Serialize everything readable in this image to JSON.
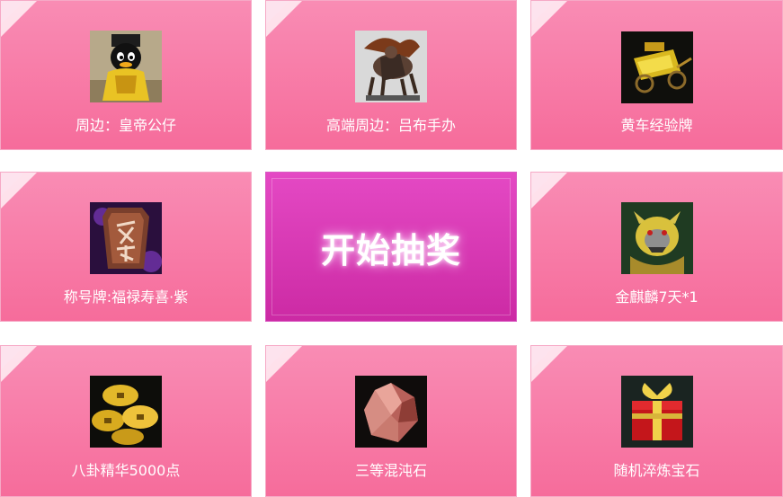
{
  "prizes": [
    {
      "label": "周边：皇帝公仔",
      "icon": "emperor-penguin-doll-icon"
    },
    {
      "label": "高端周边：吕布手办",
      "icon": "lubu-figure-icon"
    },
    {
      "label": "黄车经验牌",
      "icon": "yellow-cart-icon"
    },
    {
      "label": "称号牌:福禄寿喜·紫",
      "icon": "title-plaque-icon"
    },
    {
      "label": "金麒麟7天*1",
      "icon": "golden-qilin-icon"
    },
    {
      "label": "八卦精华5000点",
      "icon": "gold-coins-icon"
    },
    {
      "label": "三等混沌石",
      "icon": "chaos-stone-icon"
    },
    {
      "label": "随机淬炼宝石",
      "icon": "gift-box-icon"
    }
  ],
  "start_button": {
    "label": "开始抽奖"
  },
  "colors": {
    "tile": "#f66c9b",
    "start": "#d535b1"
  }
}
